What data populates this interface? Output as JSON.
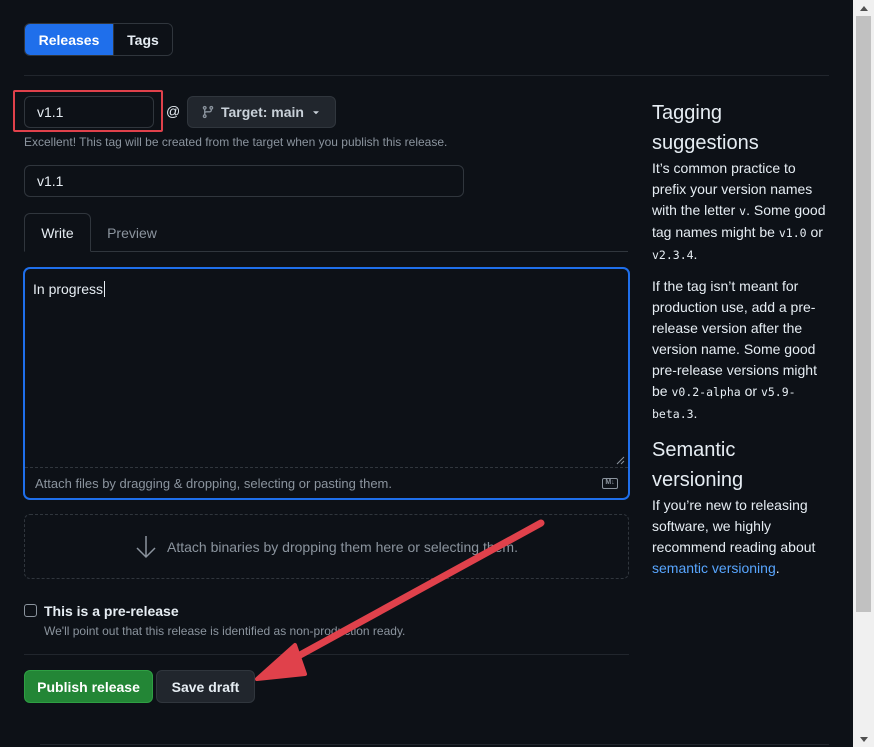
{
  "tabs": {
    "releases": "Releases",
    "tags": "Tags"
  },
  "tag_input": {
    "value": "v1.1"
  },
  "at_symbol": "@",
  "target_button": {
    "label": "Target: main"
  },
  "tag_hint": "Excellent! This tag will be created from the target when you publish this release.",
  "title_input": {
    "value": "v1.1"
  },
  "editor_tabs": {
    "write": "Write",
    "preview": "Preview"
  },
  "editor": {
    "value": "In progress",
    "attach_hint": "Attach files by dragging & dropping, selecting or pasting them."
  },
  "binaries": {
    "label": "Attach binaries by dropping them here or selecting them."
  },
  "prerelease": {
    "label": "This is a pre-release",
    "note": "We'll point out that this release is identified as non-production ready."
  },
  "buttons": {
    "publish": "Publish release",
    "draft": "Save draft"
  },
  "sidebar": {
    "tagging_title": "Tagging suggestions",
    "p1_a": "It’s common practice to prefix your version names with the letter ",
    "p1_code1": "v",
    "p1_b": ". Some good tag names might be ",
    "p1_code2": "v1.0",
    "p1_c": " or ",
    "p1_code3": "v2.3.4",
    "p1_d": ".",
    "p2_a": "If the tag isn’t meant for production use, add a pre-release version after the version name. Some good pre-release versions might be ",
    "p2_code1": "v0.2-alpha",
    "p2_b": " or ",
    "p2_code2": "v5.9-beta.3",
    "p2_c": ".",
    "semver_title": "Semantic versioning",
    "p3_a": "If you’re new to releasing software, we highly recommend reading about ",
    "p3_link": "semantic versioning",
    "p3_b": "."
  },
  "colors": {
    "background": "#0d1117",
    "accent_blue": "#1f6feb",
    "publish_green": "#238636",
    "annotation_red": "#e0414b",
    "link": "#58a6ff"
  }
}
